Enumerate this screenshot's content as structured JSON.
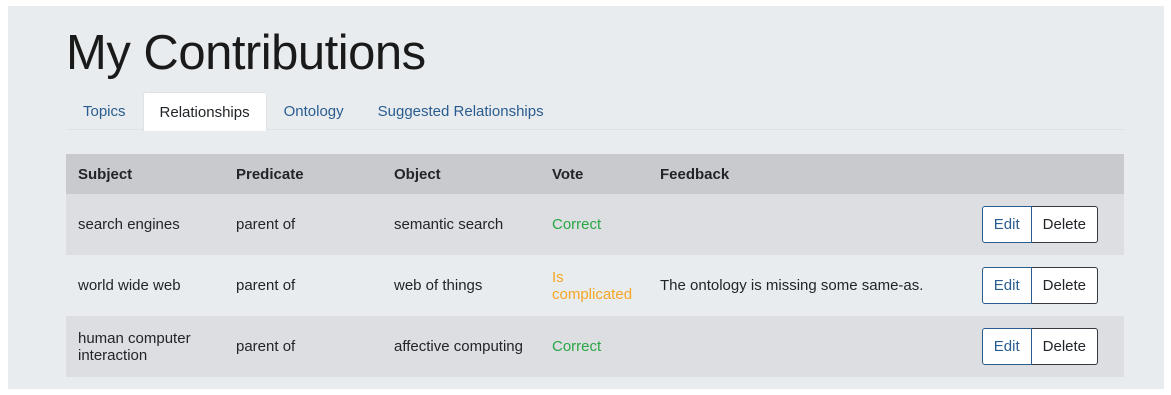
{
  "page": {
    "title": "My Contributions"
  },
  "tabs": [
    {
      "label": "Topics",
      "active": false
    },
    {
      "label": "Relationships",
      "active": true
    },
    {
      "label": "Ontology",
      "active": false
    },
    {
      "label": "Suggested Relationships",
      "active": false
    }
  ],
  "table": {
    "headers": [
      "Subject",
      "Predicate",
      "Object",
      "Vote",
      "Feedback"
    ],
    "rows": [
      {
        "subject": "search engines",
        "predicate": "parent of",
        "object": "semantic search",
        "vote": "Correct",
        "feedback": ""
      },
      {
        "subject": "world wide web",
        "predicate": "parent of",
        "object": "web of things",
        "vote": "Is complicated",
        "feedback": "The ontology is missing some same-as."
      },
      {
        "subject": "human computer interaction",
        "predicate": "parent of",
        "object": "affective computing",
        "vote": "Correct",
        "feedback": ""
      }
    ]
  },
  "actions": {
    "edit_label": "Edit",
    "delete_label": "Delete"
  },
  "colors": {
    "link": "#2a5d8f",
    "vote_correct": "#28a745",
    "vote_complicated": "#f5a623",
    "panel_bg": "#e9ecef"
  }
}
